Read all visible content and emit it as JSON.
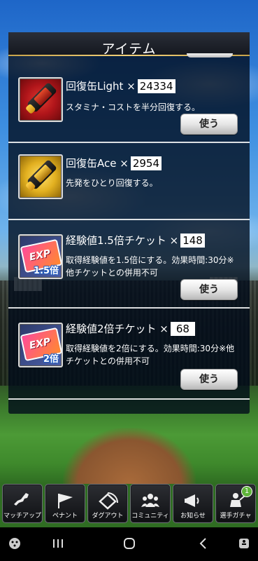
{
  "panel": {
    "title": "アイテム"
  },
  "items": [
    {
      "name": "回復缶Light ×",
      "qty": "24334",
      "desc": "スタミナ・コストを半分回復する。",
      "button": "使う",
      "icon": "red-spray-can-icon"
    },
    {
      "name": "回復缶Ace ×",
      "qty": "2954",
      "desc": "先発をひとり回復する。",
      "icon": "gold-spray-can-icon"
    },
    {
      "name": "経験値1.5倍チケット ×",
      "qty": "148",
      "desc": "取得経験値を1.5倍にする。効果時間:30分※他チケットとの併用不可",
      "button": "使う",
      "icon": "exp-ticket-icon",
      "icon_text": "EXP",
      "icon_mult": "1.5倍"
    },
    {
      "name": "経験値2倍チケット ×",
      "qty": "68",
      "desc": "取得経験値を2倍にする。効果時間:30分※他チケットとの併用不可",
      "button": "使う",
      "icon": "exp-ticket-icon",
      "icon_text": "EXP",
      "icon_mult": "2倍"
    }
  ],
  "menu": [
    {
      "label": "マッチアップ",
      "icon": "map-icon"
    },
    {
      "label": "ペナント",
      "icon": "pennant-icon"
    },
    {
      "label": "ダグアウト",
      "icon": "diamond-field-icon"
    },
    {
      "label": "コミュニティ",
      "icon": "people-icon"
    },
    {
      "label": "お知らせ",
      "icon": "megaphone-icon"
    },
    {
      "label": "選手ガチャ",
      "icon": "player-icon",
      "badge": "1"
    }
  ],
  "colors": {
    "panel_bg": "#000a19",
    "gold_accent": "#c8a44a",
    "badge": "#5fb43a"
  }
}
